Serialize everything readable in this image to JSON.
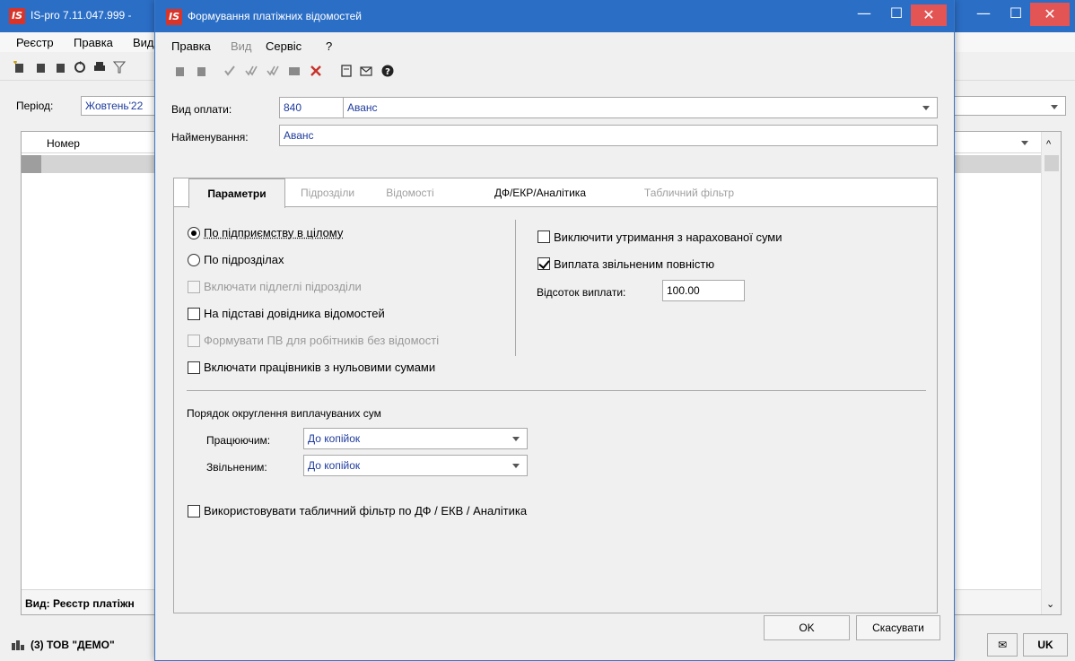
{
  "main": {
    "title": "IS-pro 7.11.047.999 -",
    "menu": [
      "Реєстр",
      "Правка",
      "Вид"
    ],
    "period": {
      "label": "Період:",
      "value": "Жовтень'22"
    },
    "grid": {
      "column_header": "Номер",
      "footer": "Вид: Реєстр платіжн"
    },
    "status": {
      "company": "(3) ТОВ \"ДЕМО\"",
      "lang": "UK"
    }
  },
  "dialog": {
    "title": "Формування платіжних відомостей",
    "menu": [
      "Правка",
      "Вид",
      "Сервіс",
      "?"
    ],
    "pay_type": {
      "label": "Вид оплати:",
      "code": "840",
      "name": "Аванс"
    },
    "naming": {
      "label": "Найменування:",
      "value": "Аванс"
    },
    "tabs": [
      "Параметри",
      "Підрозділи",
      "Відомості",
      "ДФ/ЕКР/Аналітика",
      "Табличний фільтр"
    ],
    "params": {
      "radio_enterprise": "По підприємству в цілому",
      "radio_divisions": "По підрозділах",
      "include_subdivisions": "Включати підлеглі підрозділи",
      "based_on_directory": "На підставі довідника відомостей",
      "form_pv_workers": "Формувати ПВ для робітників без відомості",
      "include_zero": "Включати працівників з нульовими сумами",
      "exclude_deductions": "Виключити утримання з нарахованої суми",
      "pay_dismissed": "Виплата звільненим повністю",
      "percent": {
        "label": "Відсоток виплати:",
        "value": "100.00"
      },
      "rounding_title": "Порядок округлення виплачуваних сум",
      "working": {
        "label": "Працюючим:",
        "value": "До копійок"
      },
      "dismissed": {
        "label": "Звільненим:",
        "value": "До копійок"
      },
      "use_table_filter": "Використовувати табличний фільтр по ДФ / ЕКВ / Аналітика"
    },
    "ok": "OK",
    "cancel": "Скасувати"
  }
}
